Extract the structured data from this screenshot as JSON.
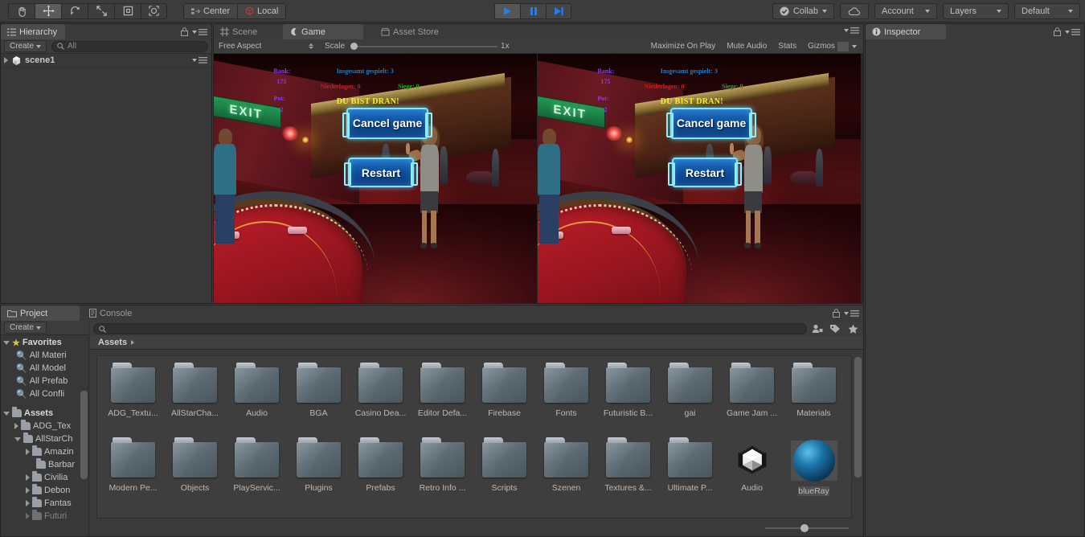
{
  "toolbar": {
    "tools": [
      {
        "name": "hand-tool",
        "icon": "hand"
      },
      {
        "name": "move-tool",
        "icon": "move"
      },
      {
        "name": "rotate-tool",
        "icon": "rotate"
      },
      {
        "name": "scale-tool",
        "icon": "scale"
      },
      {
        "name": "rect-tool",
        "icon": "rect"
      },
      {
        "name": "transform-tool",
        "icon": "transform"
      }
    ],
    "pivot_label": "Center",
    "handle_label": "Local",
    "play_label": "play",
    "pause_label": "pause",
    "step_label": "step",
    "collab_label": "Collab",
    "cloud_label": "cloud",
    "account_label": "Account",
    "layers_label": "Layers",
    "layout_label": "Default"
  },
  "hierarchy": {
    "tab_label": "Hierarchy",
    "create_label": "Create",
    "search_placeholder": "All",
    "scene_name": "scene1"
  },
  "gameview": {
    "tabs": [
      {
        "label": "Scene",
        "active": false,
        "icon": "grid-icon"
      },
      {
        "label": "Game",
        "active": true,
        "icon": "gamepad-icon"
      },
      {
        "label": "Asset Store",
        "active": false,
        "icon": "store-icon"
      }
    ],
    "aspect_label": "Free Aspect",
    "scale_label": "Scale",
    "scale_value": "1x",
    "maximize_label": "Maximize On Play",
    "mute_label": "Mute Audio",
    "stats_label": "Stats",
    "gizmos_label": "Gizmos"
  },
  "game_hud": {
    "bank_label": "Bank:",
    "bank_value": "175",
    "pot_label": "Pot:",
    "pot_value": "2",
    "played_label": "Insgesamt gespielt: 3",
    "losses_label": "Niederlagen: 0",
    "wins_label": "Siege: 0",
    "turn_label": "DU BIST DRAN!",
    "cancel_button": "Cancel game",
    "restart_button": "Restart",
    "exit_sign": "EXIT",
    "colors": {
      "bank": "#8a3df0",
      "played": "#1f7fc4",
      "losses": "#c41f1f",
      "wins": "#1ea81e",
      "turn": "#f2f232",
      "button_accent": "#7fe6f5"
    }
  },
  "project": {
    "tabs": [
      {
        "label": "Project",
        "active": true,
        "icon": "folder-icon"
      },
      {
        "label": "Console",
        "active": false,
        "icon": "console-icon"
      }
    ],
    "create_label": "Create",
    "breadcrumb": "Assets",
    "search_placeholder": "",
    "favorites": {
      "label": "Favorites",
      "items": [
        "All Materi",
        "All Model",
        "All Prefab",
        "All Confli"
      ]
    },
    "tree": [
      {
        "label": "Assets",
        "depth": 0,
        "expanded": true,
        "bold": true
      },
      {
        "label": "ADG_Tex",
        "depth": 1,
        "expanded": false,
        "bold": false
      },
      {
        "label": "AllStarCh",
        "depth": 1,
        "expanded": true,
        "bold": false
      },
      {
        "label": "Amazin",
        "depth": 2,
        "expanded": false,
        "bold": false
      },
      {
        "label": "Barbar",
        "depth": 2,
        "expanded": null,
        "bold": false
      },
      {
        "label": "Civilia",
        "depth": 2,
        "expanded": false,
        "bold": false
      },
      {
        "label": "Debon",
        "depth": 2,
        "expanded": false,
        "bold": false
      },
      {
        "label": "Fantas",
        "depth": 2,
        "expanded": false,
        "bold": false
      },
      {
        "label": "Futuri",
        "depth": 2,
        "expanded": false,
        "bold": false
      }
    ],
    "assets": [
      {
        "label": "ADG_Textu...",
        "type": "folder",
        "selected": false
      },
      {
        "label": "AllStarCha...",
        "type": "folder",
        "selected": false
      },
      {
        "label": "Audio",
        "type": "folder",
        "selected": false
      },
      {
        "label": "BGA",
        "type": "folder",
        "selected": false
      },
      {
        "label": "Casino Dea...",
        "type": "folder",
        "selected": false
      },
      {
        "label": "Editor Defa...",
        "type": "folder",
        "selected": false
      },
      {
        "label": "Firebase",
        "type": "folder",
        "selected": false
      },
      {
        "label": "Fonts",
        "type": "folder",
        "selected": false
      },
      {
        "label": "Futuristic B...",
        "type": "folder",
        "selected": false
      },
      {
        "label": "gai",
        "type": "folder",
        "selected": false
      },
      {
        "label": "Game Jam ...",
        "type": "folder",
        "selected": false
      },
      {
        "label": "Materials",
        "type": "folder",
        "selected": false
      },
      {
        "label": "Modern Pe...",
        "type": "folder",
        "selected": false
      },
      {
        "label": "Objects",
        "type": "folder",
        "selected": false
      },
      {
        "label": "PlayServic...",
        "type": "folder",
        "selected": false
      },
      {
        "label": "Plugins",
        "type": "folder",
        "selected": false
      },
      {
        "label": "Prefabs",
        "type": "folder",
        "selected": false
      },
      {
        "label": "Retro Info ...",
        "type": "folder",
        "selected": false
      },
      {
        "label": "Scripts",
        "type": "folder",
        "selected": false
      },
      {
        "label": "Szenen",
        "type": "folder",
        "selected": false
      },
      {
        "label": "Textures &...",
        "type": "folder",
        "selected": false
      },
      {
        "label": "Ultimate P...",
        "type": "folder",
        "selected": false
      },
      {
        "label": "Audio",
        "type": "unity-asset",
        "selected": false
      },
      {
        "label": "blueRay",
        "type": "material",
        "selected": true
      }
    ]
  },
  "inspector": {
    "tab_label": "Inspector"
  }
}
